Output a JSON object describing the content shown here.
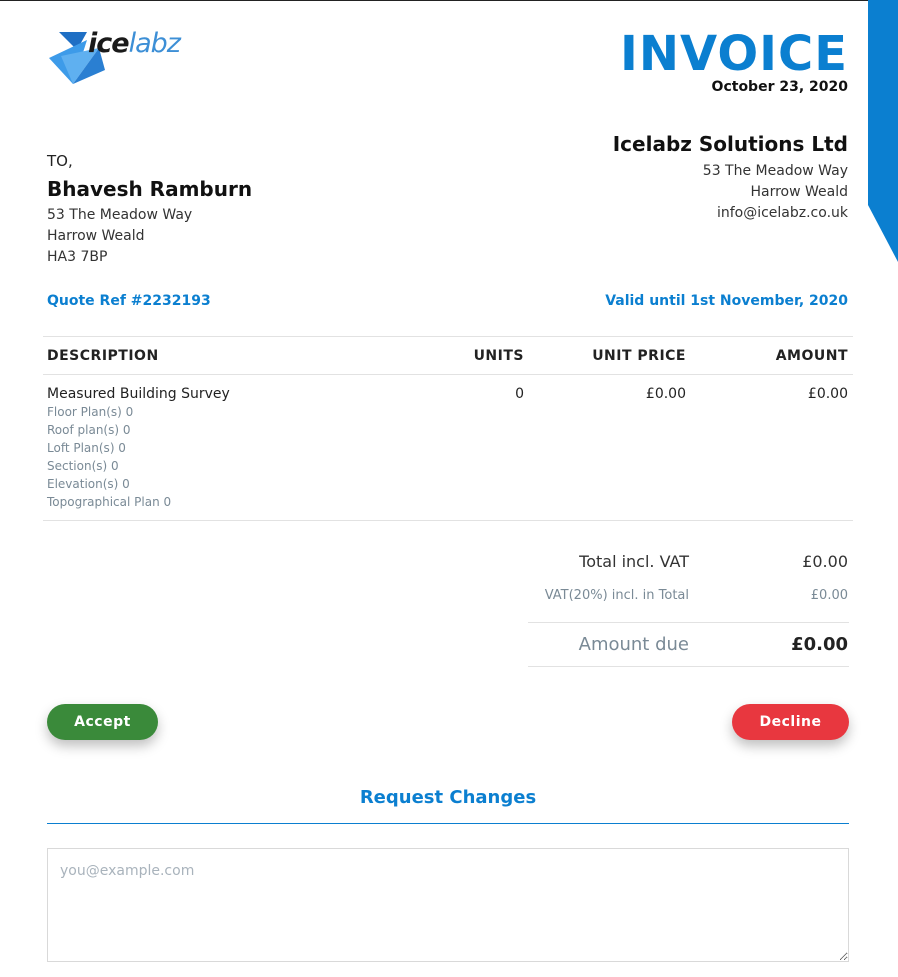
{
  "colors": {
    "accent": "#0b7fd0",
    "accept": "#3a8a3a",
    "decline": "#e8373f",
    "muted": "#7a8a96"
  },
  "brand": {
    "logo_part1": "ice",
    "logo_part2": "labz",
    "logo_icon": "triangle-logo-icon"
  },
  "header": {
    "title": "INVOICE",
    "date": "October 23, 2020"
  },
  "company": {
    "name": "Icelabz Solutions Ltd",
    "address_line1": "53 The Meadow Way",
    "address_line2": "Harrow Weald",
    "email": "info@icelabz.co.uk"
  },
  "client": {
    "to_label": "TO,",
    "name": "Bhavesh Ramburn",
    "address_line1": "53 The Meadow Way",
    "address_line2": "Harrow Weald",
    "postcode": "HA3 7BP"
  },
  "quote": {
    "ref": "Quote Ref #2232193",
    "valid_until": "Valid until 1st November, 2020"
  },
  "table": {
    "headers": {
      "description": "DESCRIPTION",
      "units": "UNITS",
      "unit_price": "UNIT PRICE",
      "amount": "AMOUNT"
    },
    "rows": [
      {
        "description": "Measured Building Survey",
        "units": "0",
        "unit_price": "£0.00",
        "amount": "£0.00",
        "sub_items": [
          "Floor Plan(s) 0",
          "Roof plan(s) 0",
          "Loft Plan(s) 0",
          "Section(s) 0",
          "Elevation(s) 0",
          "Topographical Plan 0"
        ]
      }
    ]
  },
  "summary": {
    "total_label": "Total incl. VAT",
    "total_value": "£0.00",
    "vat_label": "VAT(20%) incl. in Total",
    "vat_value": "£0.00",
    "due_label": "Amount due",
    "due_value": "£0.00"
  },
  "actions": {
    "accept_label": "Accept",
    "decline_label": "Decline"
  },
  "request_changes": {
    "title": "Request Changes",
    "placeholder": "you@example.com"
  }
}
